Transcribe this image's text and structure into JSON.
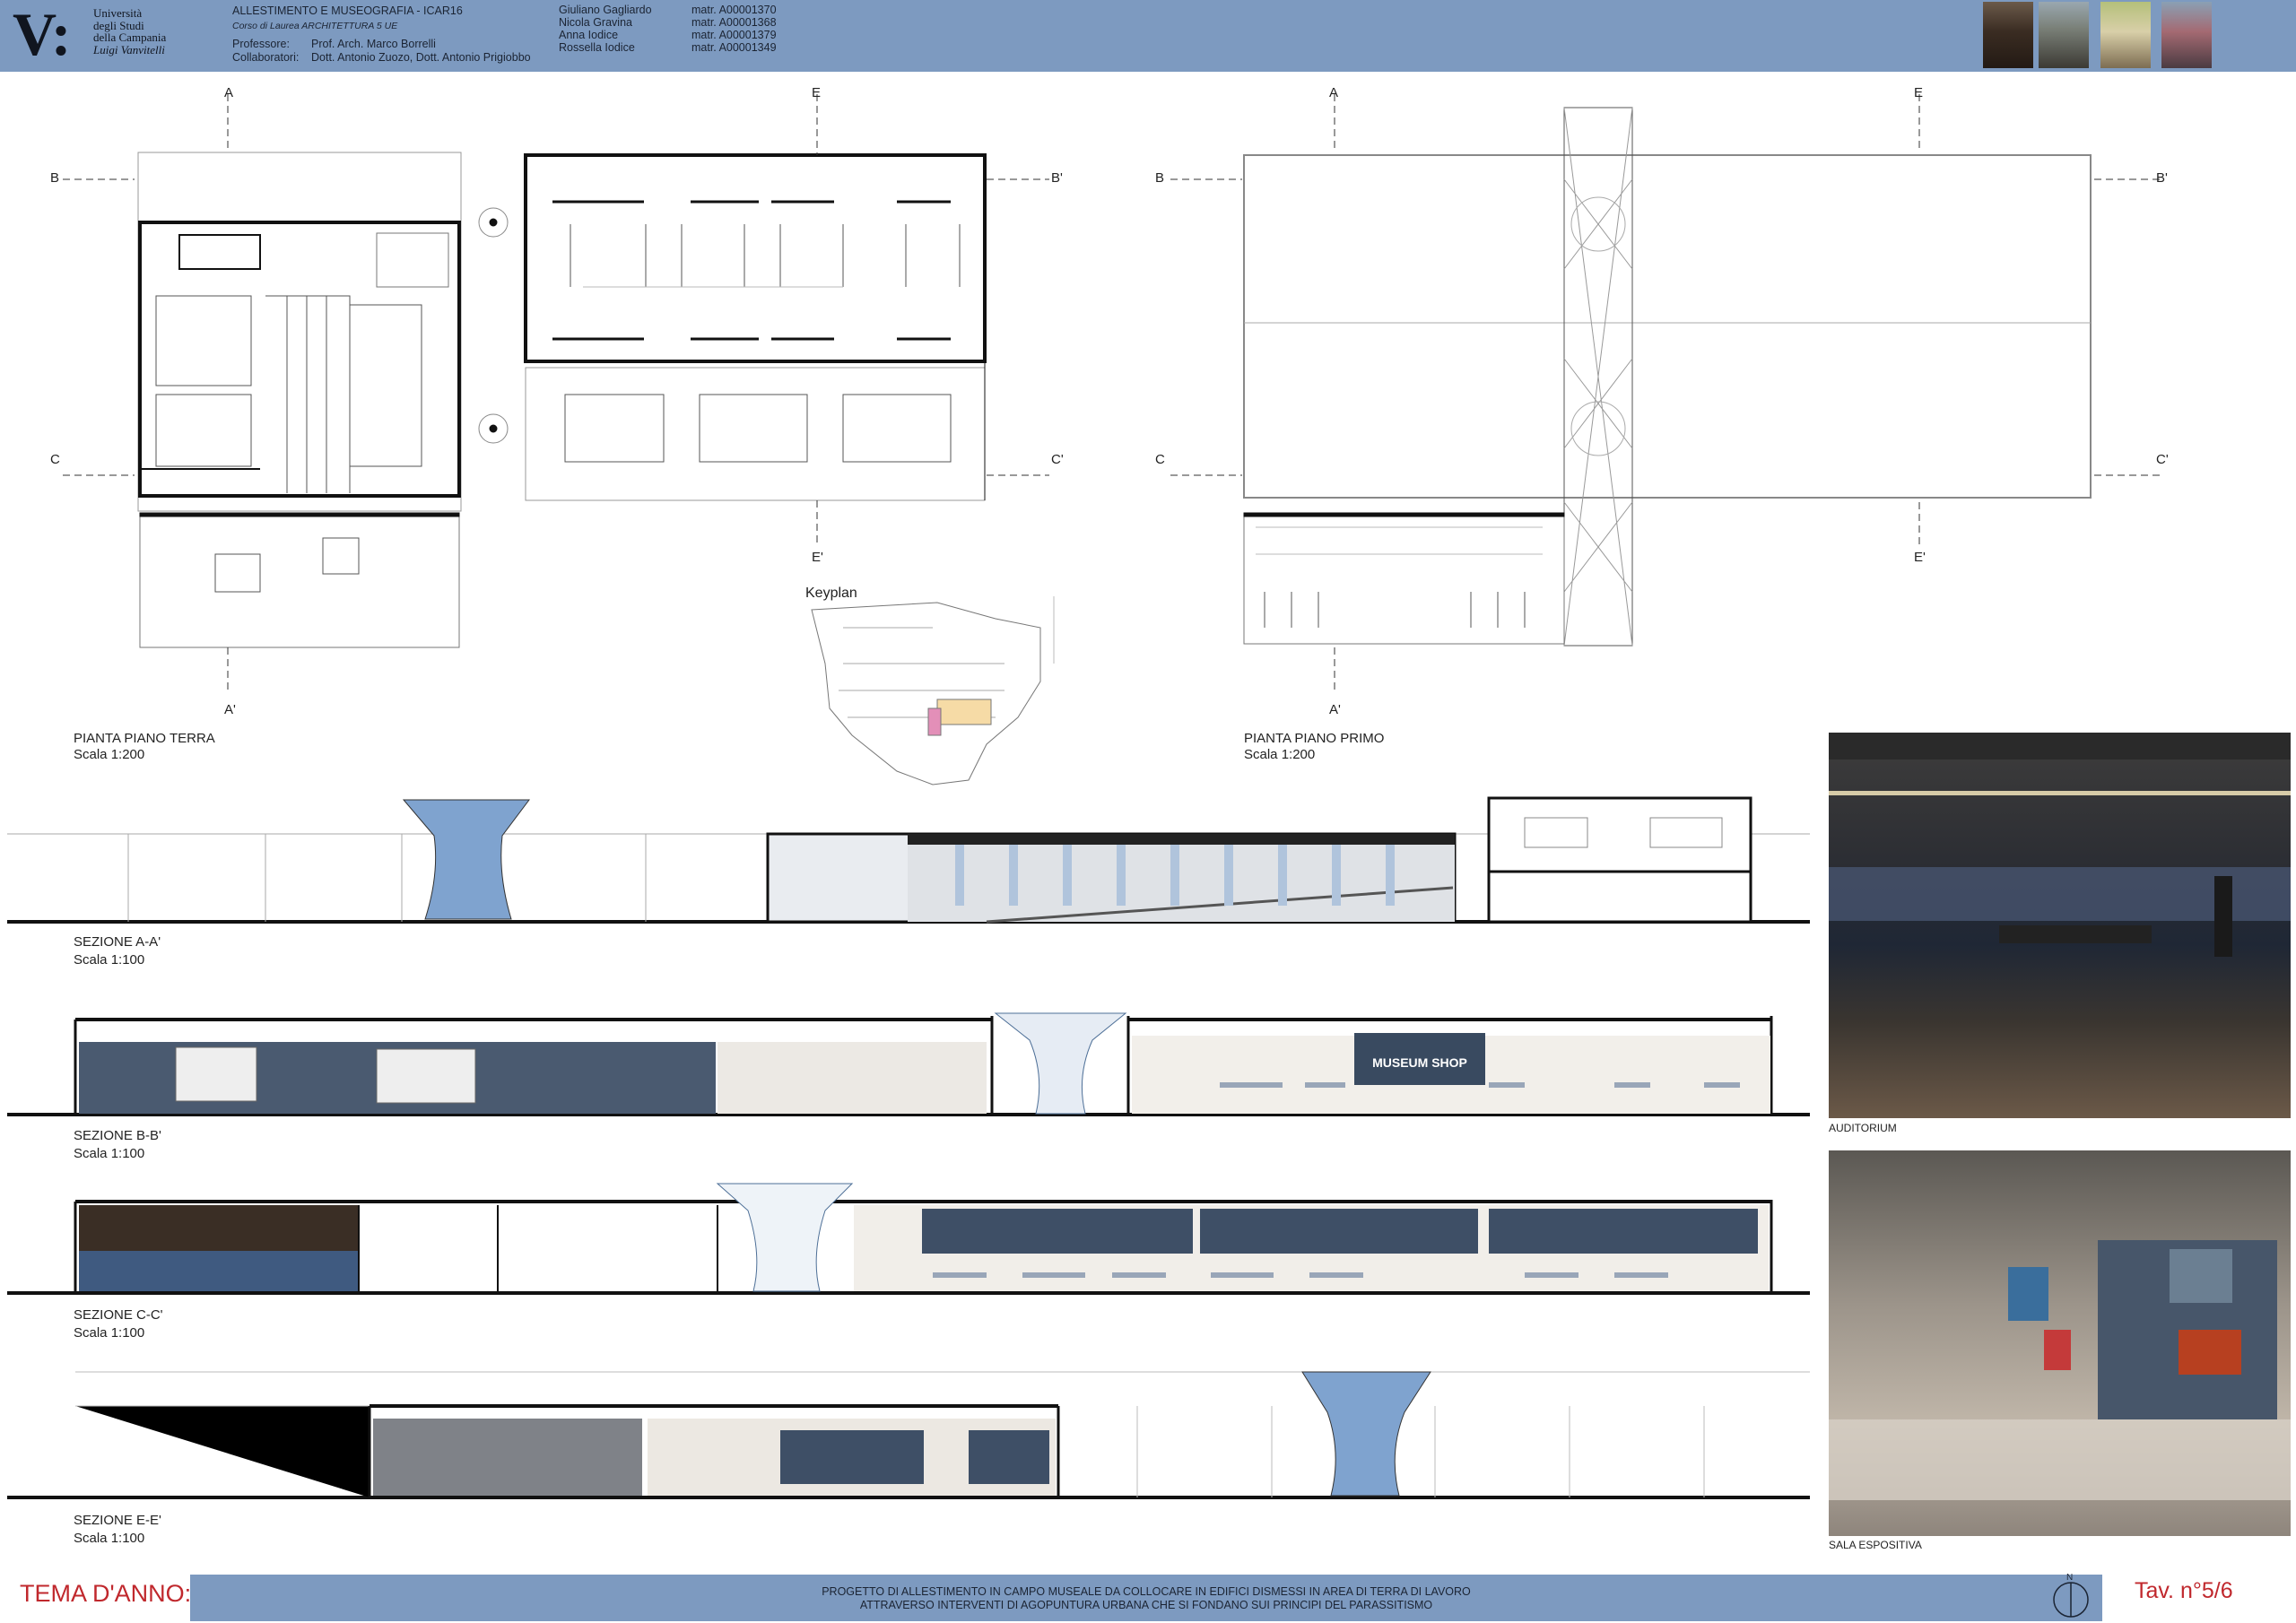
{
  "header": {
    "university": [
      "Università",
      "degli Studi",
      "della Campania"
    ],
    "university_name": "Luigi Vanvitelli",
    "course_title": "ALLESTIMENTO E MUSEOGRAFIA - ICAR16",
    "course_sub": "Corso di Laurea ARCHITETTURA 5 UE",
    "prof_label": "Professore:",
    "prof_value": "Prof. Arch. Marco Borrelli",
    "collab_label": "Collaboratori:",
    "collab_value": "Dott. Antonio Zuozo, Dott. Antonio Prigiobbo",
    "students": [
      {
        "name": "Giuliano Gagliardo",
        "matr": "matr. A00001370"
      },
      {
        "name": "Nicola Gravina",
        "matr": "matr. A00001368"
      },
      {
        "name": "Anna Iodice",
        "matr": "matr. A00001379"
      },
      {
        "name": "Rossella Iodice",
        "matr": "matr. A00001349"
      }
    ]
  },
  "plans": {
    "ground": {
      "title": "PIANTA PIANO TERRA",
      "scale": "Scala 1:200"
    },
    "first": {
      "title": "PIANTA PIANO PRIMO",
      "scale": "Scala 1:200"
    },
    "keyplan": "Keyplan",
    "section_marks": [
      "A",
      "B",
      "C",
      "E",
      "A'",
      "B'",
      "C'",
      "E'"
    ]
  },
  "sections": [
    {
      "title": "SEZIONE A-A'",
      "scale": "Scala 1:100"
    },
    {
      "title": "SEZIONE B-B'",
      "scale": "Scala 1:100"
    },
    {
      "title": "SEZIONE C-C'",
      "scale": "Scala 1:100"
    },
    {
      "title": "SEZIONE E-E'",
      "scale": "Scala 1:100"
    }
  ],
  "renders": {
    "auditorium": "AUDITORIUM",
    "sala": "SALA ESPOSITIVA",
    "museum_shop": "MUSEUM SHOP"
  },
  "footer": {
    "tema": "TEMA D'ANNO:",
    "line1": "PROGETTO DI ALLESTIMENTO IN CAMPO MUSEALE DA COLLOCARE IN EDIFICI DISMESSI IN AREA DI TERRA DI LAVORO",
    "line2": "ATTRAVERSO INTERVENTI DI AGOPUNTURA URBANA CHE SI FONDANO SUI PRINCIPI DEL PARASSITISMO",
    "tav": "Tav. n°5/6",
    "north": "N"
  },
  "colors": {
    "header": "#7d9ac0",
    "accent": "#c0282d"
  }
}
